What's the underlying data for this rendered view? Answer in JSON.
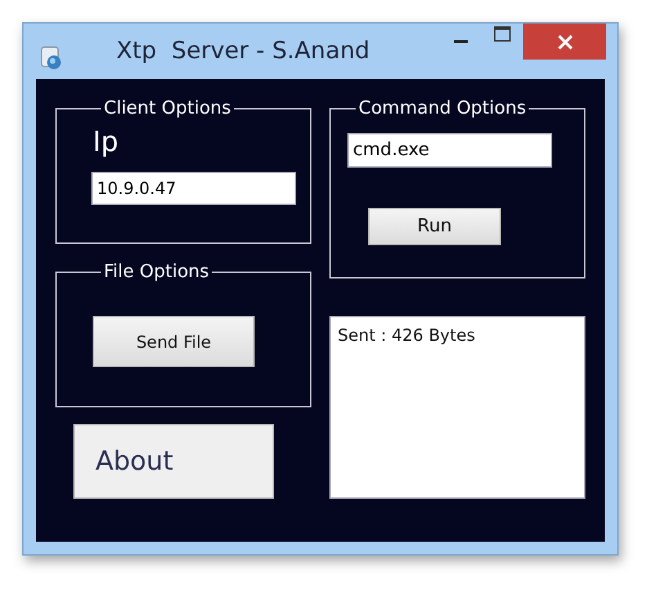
{
  "window": {
    "title": "Xtp  Server - S.Anand"
  },
  "client_options": {
    "legend": "Client Options",
    "ip_label": "Ip",
    "ip_value": "10.9.0.47"
  },
  "command_options": {
    "legend": "Command Options",
    "command_value": "cmd.exe",
    "run_button": "Run"
  },
  "file_options": {
    "legend": "File Options",
    "send_button": "Send File"
  },
  "about_button": "About",
  "output": {
    "text": "Sent : 426 Bytes"
  }
}
